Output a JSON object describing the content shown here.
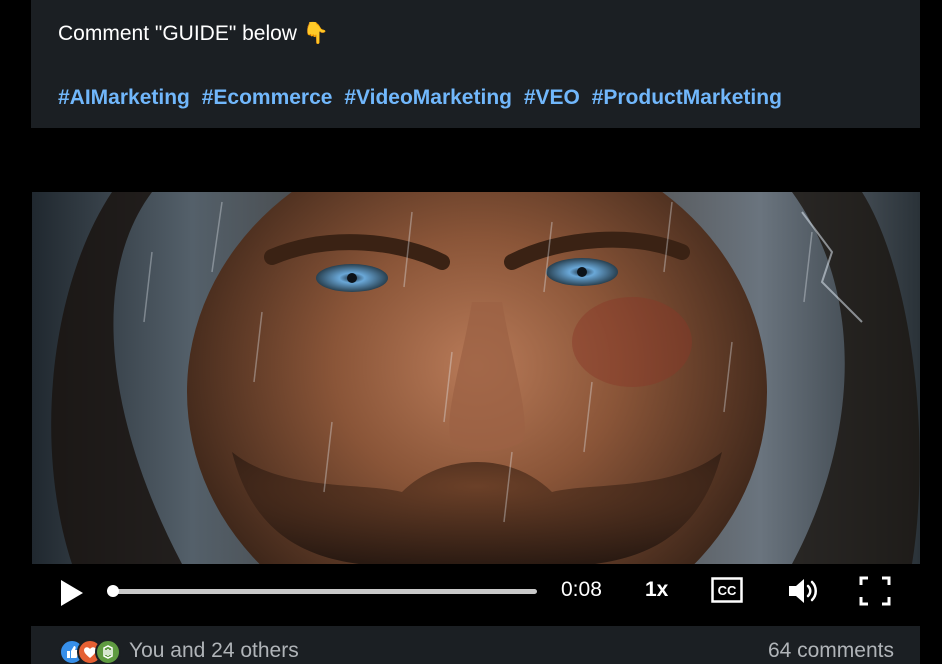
{
  "post": {
    "text": "Comment \"GUIDE\" below",
    "emoji": "👇",
    "hashtags": [
      "#AIMarketing",
      "#Ecommerce",
      "#VideoMarketing",
      "#VEO",
      "#ProductMarketing"
    ]
  },
  "video": {
    "current_time": "0:08",
    "speed": "1x",
    "progress": 0.01,
    "cc_label": "CC"
  },
  "social": {
    "reactions": [
      "like-icon",
      "love-icon",
      "celebrate-icon"
    ],
    "reactions_text": "You and 24 others",
    "comments_text": "64 comments"
  },
  "colors": {
    "card_bg": "#1b1f23",
    "hashtag": "#71b7fb",
    "muted_text": "#b0b4b8"
  }
}
